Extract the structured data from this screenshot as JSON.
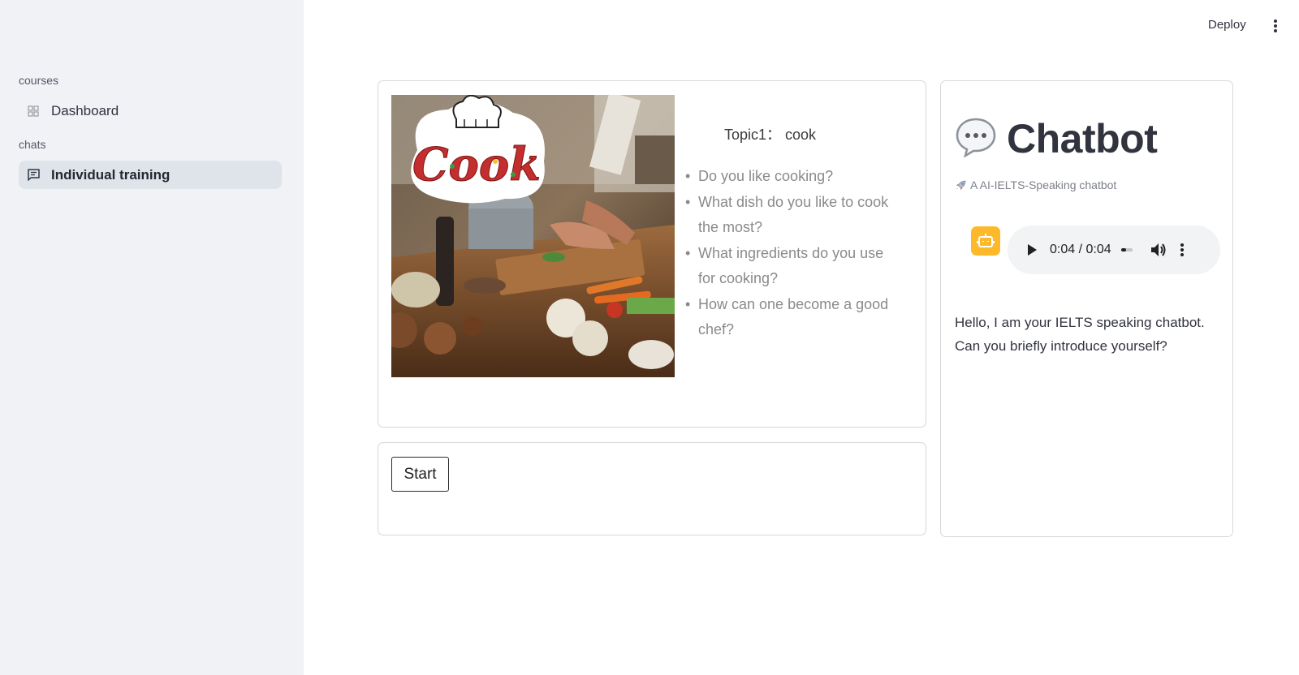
{
  "sidebar": {
    "sections": [
      {
        "label": "courses",
        "items": [
          {
            "label": "Dashboard",
            "icon": "grid-icon",
            "active": false
          }
        ]
      },
      {
        "label": "chats",
        "items": [
          {
            "label": "Individual training",
            "icon": "chat-icon",
            "active": true
          }
        ]
      }
    ]
  },
  "header": {
    "deploy_label": "Deploy",
    "menu_icon": "kebab-menu-icon"
  },
  "topic_card": {
    "image_text": "Cook",
    "title": "Topic1： cook",
    "questions": [
      "Do you like cooking?",
      "What dish do you like to cook the most?",
      "What ingredients do you use for cooking?",
      "How can one become a good chef?"
    ]
  },
  "start_card": {
    "button_label": "Start"
  },
  "chat": {
    "title_icon": "speech-bubble-icon",
    "title": "Chatbot",
    "caption_icon": "rocket-icon",
    "caption": "A AI-IELTS-Speaking chatbot",
    "avatar_color": "#fdb92a",
    "audio": {
      "time": "0:04 / 0:04",
      "progress": 0.4
    },
    "message": "Hello, I am your IELTS speaking chatbot. Can you briefly introduce yourself?"
  }
}
